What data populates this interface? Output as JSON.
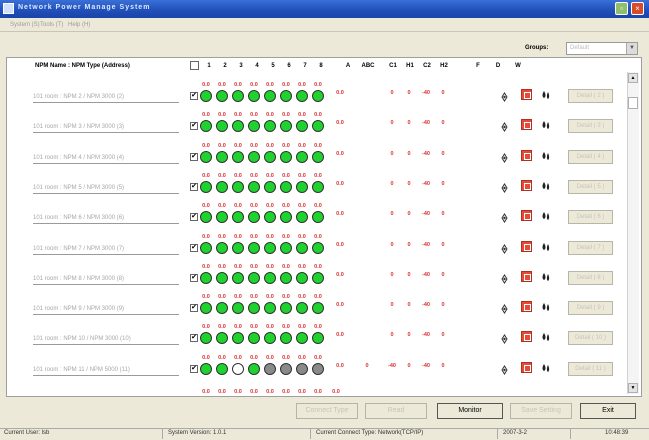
{
  "window": {
    "title": "Network Power Manage System"
  },
  "menu": [
    "System (S)",
    "Tools (T)",
    "Help (H)"
  ],
  "groups": {
    "label": "Groups:",
    "value": "Default"
  },
  "table": {
    "name_header": "NPM Name : NPM Type (Address)",
    "columns": [
      "1",
      "2",
      "3",
      "4",
      "5",
      "6",
      "7",
      "8",
      "A",
      "ABC",
      "C1",
      "H1",
      "C2",
      "H2",
      "F",
      "D",
      "W"
    ]
  },
  "rows": [
    {
      "name": "101 room : NPM 2 / NPM 3000 (2)",
      "checked": true,
      "outlets": [
        "0.0",
        "0.0",
        "0.0",
        "0.0",
        "0.0",
        "0.0",
        "0.0",
        "0.0"
      ],
      "leds": [
        "on",
        "on",
        "on",
        "on",
        "on",
        "on",
        "on",
        "on"
      ],
      "A": "0.0",
      "ABC": "",
      "C1": "0",
      "H1": "0",
      "C2": "-40",
      "H2": "0",
      "detail": "Detail ( 2 )"
    },
    {
      "name": "101 room : NPM 3 / NPM 3000 (3)",
      "checked": true,
      "outlets": [
        "0.0",
        "0.0",
        "0.0",
        "0.0",
        "0.0",
        "0.0",
        "0.0",
        "0.0"
      ],
      "leds": [
        "on",
        "on",
        "on",
        "on",
        "on",
        "on",
        "on",
        "on"
      ],
      "A": "0.0",
      "ABC": "",
      "C1": "0",
      "H1": "0",
      "C2": "-40",
      "H2": "0",
      "detail": "Detail ( 3 )"
    },
    {
      "name": "101 room : NPM 4 / NPM 3000 (4)",
      "checked": true,
      "outlets": [
        "0.0",
        "0.0",
        "0.0",
        "0.0",
        "0.0",
        "0.0",
        "0.0",
        "0.0"
      ],
      "leds": [
        "on",
        "on",
        "on",
        "on",
        "on",
        "on",
        "on",
        "on"
      ],
      "A": "0.0",
      "ABC": "",
      "C1": "0",
      "H1": "0",
      "C2": "-40",
      "H2": "0",
      "detail": "Detail ( 4 )"
    },
    {
      "name": "101 room : NPM 5 / NPM 3000 (5)",
      "checked": true,
      "outlets": [
        "0.0",
        "0.0",
        "0.0",
        "0.0",
        "0.0",
        "0.0",
        "0.0",
        "0.0"
      ],
      "leds": [
        "on",
        "on",
        "on",
        "on",
        "on",
        "on",
        "on",
        "on"
      ],
      "A": "0.0",
      "ABC": "",
      "C1": "0",
      "H1": "0",
      "C2": "-40",
      "H2": "0",
      "detail": "Detail ( 5 )"
    },
    {
      "name": "101 room : NPM 6 / NPM 3000 (6)",
      "checked": true,
      "outlets": [
        "0.0",
        "0.0",
        "0.0",
        "0.0",
        "0.0",
        "0.0",
        "0.0",
        "0.0"
      ],
      "leds": [
        "on",
        "on",
        "on",
        "on",
        "on",
        "on",
        "on",
        "on"
      ],
      "A": "0.0",
      "ABC": "",
      "C1": "0",
      "H1": "0",
      "C2": "-40",
      "H2": "0",
      "detail": "Detail ( 6 )"
    },
    {
      "name": "101 room : NPM 7 / NPM 3000 (7)",
      "checked": true,
      "outlets": [
        "0.0",
        "0.0",
        "0.0",
        "0.0",
        "0.0",
        "0.0",
        "0.0",
        "0.0"
      ],
      "leds": [
        "on",
        "on",
        "on",
        "on",
        "on",
        "on",
        "on",
        "on"
      ],
      "A": "0.0",
      "ABC": "",
      "C1": "0",
      "H1": "0",
      "C2": "-40",
      "H2": "0",
      "detail": "Detail ( 7 )"
    },
    {
      "name": "101 room : NPM 8 / NPM 3000 (8)",
      "checked": true,
      "outlets": [
        "0.0",
        "0.0",
        "0.0",
        "0.0",
        "0.0",
        "0.0",
        "0.0",
        "0.0"
      ],
      "leds": [
        "on",
        "on",
        "on",
        "on",
        "on",
        "on",
        "on",
        "on"
      ],
      "A": "0.0",
      "ABC": "",
      "C1": "0",
      "H1": "0",
      "C2": "-40",
      "H2": "0",
      "detail": "Detail ( 8 )"
    },
    {
      "name": "101 room : NPM 9 / NPM 3000 (9)",
      "checked": true,
      "outlets": [
        "0.0",
        "0.0",
        "0.0",
        "0.0",
        "0.0",
        "0.0",
        "0.0",
        "0.0"
      ],
      "leds": [
        "on",
        "on",
        "on",
        "on",
        "on",
        "on",
        "on",
        "on"
      ],
      "A": "0.0",
      "ABC": "",
      "C1": "0",
      "H1": "0",
      "C2": "-40",
      "H2": "0",
      "detail": "Detail ( 9 )"
    },
    {
      "name": "101 room : NPM 10 / NPM 3000 (10)",
      "checked": true,
      "outlets": [
        "0.0",
        "0.0",
        "0.0",
        "0.0",
        "0.0",
        "0.0",
        "0.0",
        "0.0"
      ],
      "leds": [
        "on",
        "on",
        "on",
        "on",
        "on",
        "on",
        "on",
        "on"
      ],
      "A": "0.0",
      "ABC": "",
      "C1": "0",
      "H1": "0",
      "C2": "-40",
      "H2": "0",
      "detail": "Detail ( 10 )"
    },
    {
      "name": "101 room : NPM 11 / NPM 5000 (11)",
      "checked": true,
      "outlets": [
        "0.0",
        "0.0",
        "0.0",
        "0.0",
        "0.0",
        "0.0",
        "0.0",
        "0.0"
      ],
      "leds": [
        "on",
        "on",
        "off",
        "on",
        "gray",
        "gray",
        "gray",
        "gray"
      ],
      "A": "0.0",
      "ABC": "0",
      "C1": "-40",
      "H1": "0",
      "C2": "-40",
      "H2": "0",
      "detail": "Detail ( 11 )"
    }
  ],
  "partial_row": [
    "0.0",
    "0.0",
    "0.0",
    "0.0",
    "0.0",
    "0.0",
    "0.0",
    "0.0",
    "0.0"
  ],
  "buttons": {
    "connect_type": "Connect Type",
    "read": "Read",
    "monitor": "Monitor",
    "save_setting": "Save Setting",
    "exit": "Exit"
  },
  "status": {
    "user": "Current User: lsb",
    "version": "System Version: 1.0.1",
    "connect_type": "Current Connect Type:  Network(TCP/IP)",
    "date": "2007-3-2",
    "time": "10:48:39"
  },
  "colors": {
    "led_on": "#1ed32e",
    "led_gray": "#8a8a8a",
    "value_red": "#d93030",
    "titlebar": "#1f4fb8"
  }
}
